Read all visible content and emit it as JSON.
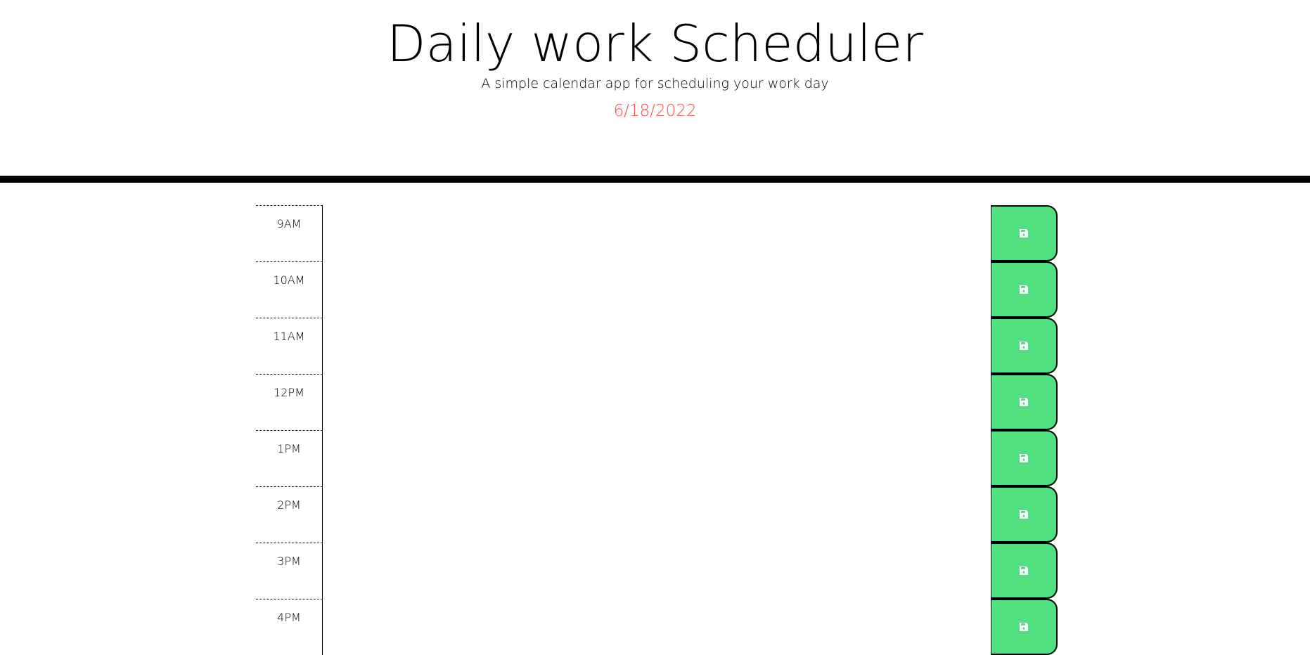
{
  "header": {
    "title": "Daily work Scheduler",
    "subtitle": "A simple calendar app for scheduling your work day",
    "current_day": "6/18/2022"
  },
  "colors": {
    "date_text": "#ef5350",
    "save_button": "#51e07f",
    "divider": "#000000"
  },
  "timeblocks": [
    {
      "hour": "9AM",
      "text": ""
    },
    {
      "hour": "10AM",
      "text": ""
    },
    {
      "hour": "11AM",
      "text": ""
    },
    {
      "hour": "12PM",
      "text": ""
    },
    {
      "hour": "1PM",
      "text": ""
    },
    {
      "hour": "2PM",
      "text": ""
    },
    {
      "hour": "3PM",
      "text": ""
    },
    {
      "hour": "4PM",
      "text": ""
    }
  ],
  "save_icon": "floppy-disk-icon"
}
